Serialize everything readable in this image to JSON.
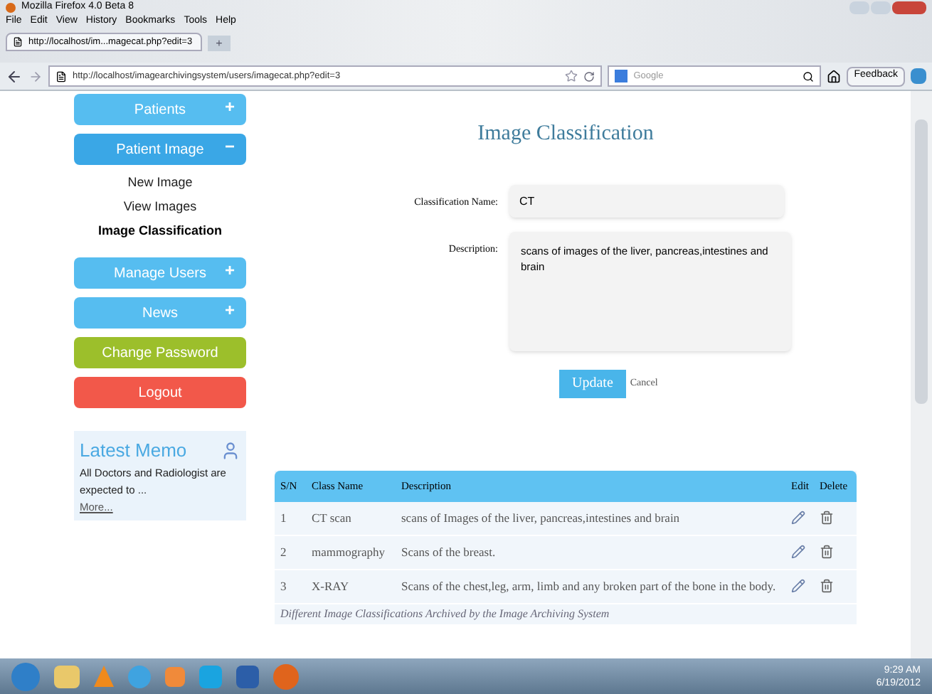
{
  "window": {
    "title": "Mozilla Firefox 4.0 Beta 8"
  },
  "menu": [
    "File",
    "Edit",
    "View",
    "History",
    "Bookmarks",
    "Tools",
    "Help"
  ],
  "tab": {
    "title": "http://localhost/im...magecat.php?edit=3",
    "new_tab": "+"
  },
  "address_bar": {
    "url": "http://localhost/imagearchivingsystem/users/imagecat.php?edit=3"
  },
  "search": {
    "placeholder": "Google"
  },
  "feedback_button": "Feedback",
  "sidebar": {
    "items": [
      {
        "kind": "section",
        "label": "Patients",
        "toggle": "+",
        "expanded": false
      },
      {
        "kind": "section",
        "label": "Patient Image",
        "toggle": "−",
        "expanded": true,
        "children": [
          {
            "label": "New Image",
            "selected": false
          },
          {
            "label": "View Images",
            "selected": false
          },
          {
            "label": "Image Classification",
            "selected": true
          }
        ]
      },
      {
        "kind": "section",
        "label": "Manage Users",
        "toggle": "+",
        "expanded": false
      },
      {
        "kind": "section",
        "label": "News",
        "toggle": "+",
        "expanded": false
      },
      {
        "kind": "action",
        "label": "Change Password",
        "color": "#9cbf2b"
      },
      {
        "kind": "action",
        "label": "Logout",
        "color": "#f2584a"
      }
    ],
    "memo": {
      "title": "Latest Memo",
      "text": "All Doctors and Radiologist are expected to ...",
      "link": "More..."
    }
  },
  "form": {
    "title": "Image Classification",
    "fields": [
      {
        "kind": "input",
        "label": "Classification Name:",
        "value": "CT"
      },
      {
        "kind": "textarea",
        "label": "Description:",
        "value": "scans of images of the liver, pancreas,intestines and brain"
      }
    ],
    "submit": "Update",
    "cancel": "Cancel"
  },
  "table": {
    "columns": [
      "S/N",
      "Class Name",
      "Description",
      "Edit",
      "Delete"
    ],
    "rows": [
      {
        "sn": "1",
        "name": "CT scan",
        "description": "scans of Images of the liver, pancreas,intestines and brain"
      },
      {
        "sn": "2",
        "name": "mammography",
        "description": "Scans of the breast."
      },
      {
        "sn": "3",
        "name": "X-RAY",
        "description": "Scans of the chest,leg, arm, limb and any broken part of the bone in the body."
      }
    ],
    "caption": "Different Image Classifications Archived by the Image Archiving System"
  },
  "taskbar": {
    "time": "9:29 AM",
    "date": "6/19/2012"
  }
}
